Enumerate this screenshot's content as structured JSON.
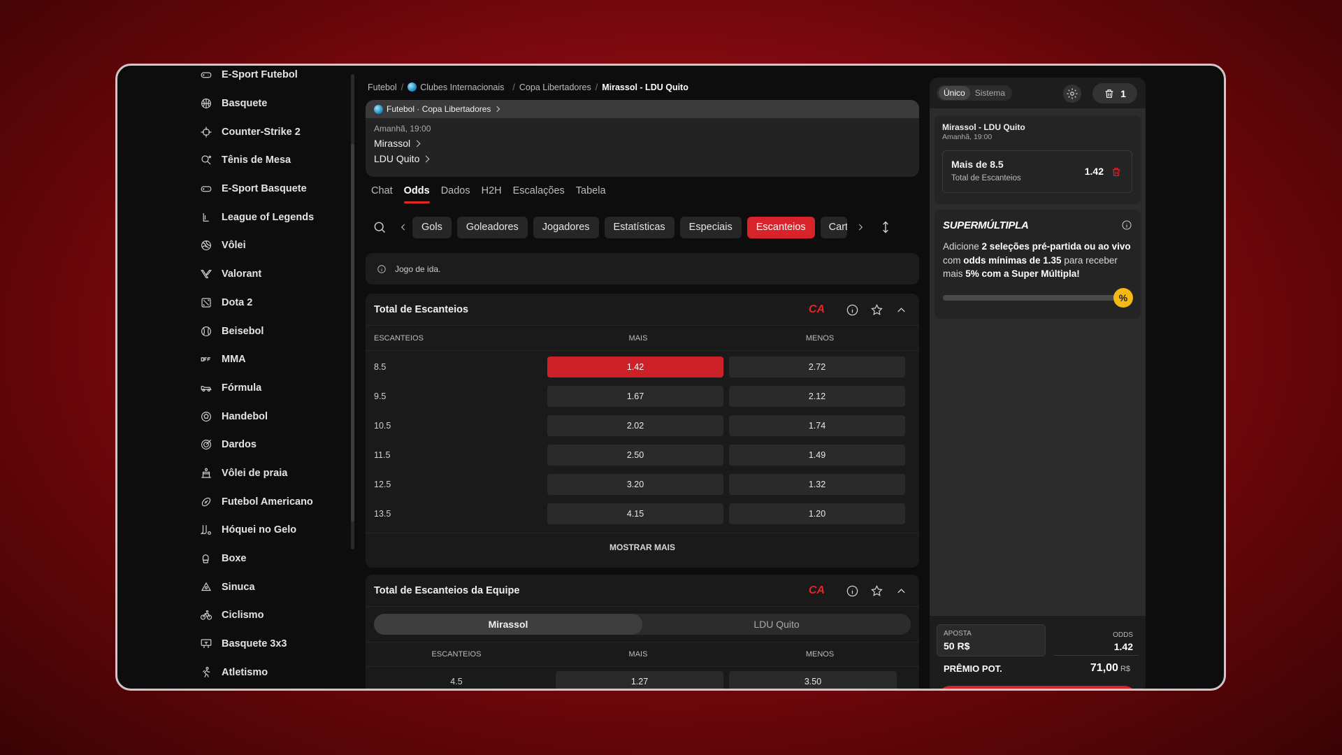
{
  "sidebar": {
    "items": [
      {
        "label": "E-Sport Futebol",
        "icon": "gamepad-icon"
      },
      {
        "label": "Basquete",
        "icon": "basketball-icon"
      },
      {
        "label": "Counter-Strike 2",
        "icon": "crosshair-icon"
      },
      {
        "label": "Tênis de Mesa",
        "icon": "ping-pong-icon"
      },
      {
        "label": "E-Sport Basquete",
        "icon": "gamepad-icon"
      },
      {
        "label": "League of Legends",
        "icon": "lol-icon"
      },
      {
        "label": "Vôlei",
        "icon": "volleyball-icon"
      },
      {
        "label": "Valorant",
        "icon": "valorant-icon"
      },
      {
        "label": "Dota 2",
        "icon": "dota-icon"
      },
      {
        "label": "Beisebol",
        "icon": "baseball-icon"
      },
      {
        "label": "MMA",
        "icon": "ufc-icon"
      },
      {
        "label": "Fórmula",
        "icon": "race-car-icon"
      },
      {
        "label": "Handebol",
        "icon": "handball-icon"
      },
      {
        "label": "Dardos",
        "icon": "darts-icon"
      },
      {
        "label": "Vôlei de praia",
        "icon": "beach-volley-icon"
      },
      {
        "label": "Futebol Americano",
        "icon": "american-football-icon"
      },
      {
        "label": "Hóquei no Gelo",
        "icon": "hockey-icon"
      },
      {
        "label": "Boxe",
        "icon": "boxing-glove-icon"
      },
      {
        "label": "Sinuca",
        "icon": "billiards-icon"
      },
      {
        "label": "Ciclismo",
        "icon": "bicycle-icon"
      },
      {
        "label": "Basquete 3x3",
        "icon": "basketball-3x3-icon"
      },
      {
        "label": "Atletismo",
        "icon": "runner-icon"
      }
    ]
  },
  "breadcrumb": {
    "items": [
      "Futebol",
      "Clubes Internacionais",
      "Copa Libertadores"
    ],
    "current": "Mirassol - LDU Quito"
  },
  "match": {
    "competition": "Futebol · Copa Libertadores",
    "time": "Amanhã, 19:00",
    "home": "Mirassol",
    "away": "LDU Quito"
  },
  "tabs": [
    "Chat",
    "Odds",
    "Dados",
    "H2H",
    "Escalações",
    "Tabela"
  ],
  "active_tab": "Odds",
  "market_pills": [
    "Gols",
    "Goleadores",
    "Jogadores",
    "Estatísticas",
    "Especiais",
    "Escanteios",
    "Cart"
  ],
  "active_pill": "Escanteios",
  "info_text": "Jogo de ida.",
  "market1": {
    "title": "Total de Escanteios",
    "badge": "CA",
    "columns": [
      "ESCANTEIOS",
      "MAIS",
      "MENOS"
    ],
    "rows": [
      {
        "line": "8.5",
        "over": "1.42",
        "under": "2.72"
      },
      {
        "line": "9.5",
        "over": "1.67",
        "under": "2.12"
      },
      {
        "line": "10.5",
        "over": "2.02",
        "under": "1.74"
      },
      {
        "line": "11.5",
        "over": "2.50",
        "under": "1.49"
      },
      {
        "line": "12.5",
        "over": "3.20",
        "under": "1.32"
      },
      {
        "line": "13.5",
        "over": "4.15",
        "under": "1.20"
      }
    ],
    "show_more": "MOSTRAR MAIS"
  },
  "market2": {
    "title": "Total de Escanteios da Equipe",
    "badge": "CA",
    "teams": [
      "Mirassol",
      "LDU Quito"
    ],
    "columns": [
      "ESCANTEIOS",
      "MAIS",
      "MENOS"
    ],
    "first_row": {
      "line": "4.5",
      "over": "1.27",
      "under": "3.50"
    }
  },
  "betslip": {
    "modes": [
      "Único",
      "Sistema"
    ],
    "active_mode": "Único",
    "count": "1",
    "selection": {
      "match": "Mirassol - LDU Quito",
      "time": "Amanhã, 19:00",
      "pick": "Mais de 8.5",
      "market": "Total de Escanteios",
      "odds": "1.42"
    },
    "supermultipla": {
      "title": "SUPERMÚLTIPLA",
      "text_a": "Adicione ",
      "text_b": "2 seleções pré-partida ou ao vivo",
      "text_c": " com ",
      "text_d": "odds mínimas de 1.35",
      "text_e": " para receber mais ",
      "text_f": "5% com a Super Múltipla!",
      "progress": 0.0,
      "badge": "%"
    },
    "stake_label": "APOSTA",
    "stake_value": "50 R$",
    "odds_label": "ODDS",
    "odds_value": "1.42",
    "prize_label": "PRÊMIO POT.",
    "prize_value": "71,00",
    "prize_currency": "R$"
  },
  "colors": {
    "accent": "#d9232a",
    "background": "#0d0d0d",
    "panel": "#1a1a1a",
    "promo": "#f5b916"
  }
}
